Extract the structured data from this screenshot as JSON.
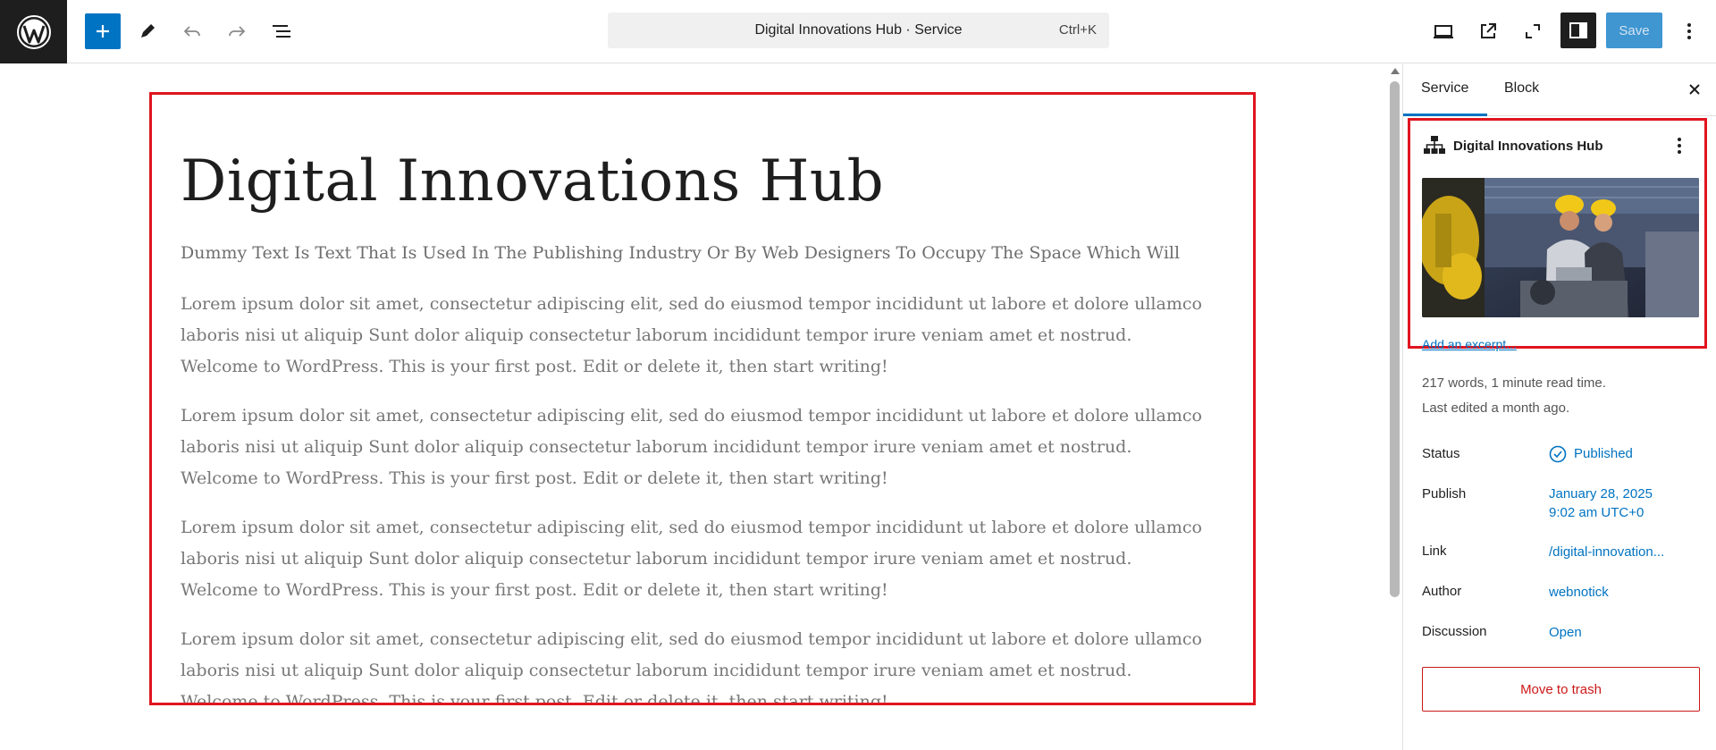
{
  "toolbar": {
    "command_title": "Digital Innovations Hub · Service",
    "command_shortcut": "Ctrl+K",
    "save_label": "Save"
  },
  "post": {
    "title": "Digital Innovations Hub",
    "excerpt": "Dummy Text Is Text That Is Used In The Publishing Industry Or By Web Designers To Occupy The Space Which Will",
    "paragraphs": [
      "Lorem ipsum dolor sit amet, consectetur adipiscing elit, sed do eiusmod tempor incididunt ut labore et dolore ullamco laboris nisi ut aliquip Sunt dolor aliquip consectetur laborum incididunt tempor irure veniam amet et nostrud. Welcome to WordPress. This is your first post. Edit or delete it, then start writing!",
      "Lorem ipsum dolor sit amet, consectetur adipiscing elit, sed do eiusmod tempor incididunt ut labore et dolore ullamco laboris nisi ut aliquip Sunt dolor aliquip consectetur laborum incididunt tempor irure veniam amet et nostrud. Welcome to WordPress. This is your first post. Edit or delete it, then start writing!",
      "Lorem ipsum dolor sit amet, consectetur adipiscing elit, sed do eiusmod tempor incididunt ut labore et dolore ullamco laboris nisi ut aliquip Sunt dolor aliquip consectetur laborum incididunt tempor irure veniam amet et nostrud. Welcome to WordPress. This is your first post. Edit or delete it, then start writing!",
      "Lorem ipsum dolor sit amet, consectetur adipiscing elit, sed do eiusmod tempor incididunt ut labore et dolore ullamco laboris nisi ut aliquip Sunt dolor aliquip consectetur laborum incididunt tempor irure veniam amet et nostrud. Welcome to WordPress. This is your first post. Edit or delete it, then start writing!"
    ]
  },
  "sidebar": {
    "tabs": [
      "Service",
      "Block"
    ],
    "card_title": "Digital Innovations Hub",
    "excerpt_link": "Add an excerpt...",
    "meta_words": "217 words, 1 minute read time.",
    "meta_edited": "Last edited a month ago.",
    "rows": {
      "status_label": "Status",
      "status_value": "Published",
      "publish_label": "Publish",
      "publish_date": "January 28, 2025",
      "publish_time": "9:02 am UTC+0",
      "link_label": "Link",
      "link_value": "/digital-innovation...",
      "author_label": "Author",
      "author_value": "webnotick",
      "discussion_label": "Discussion",
      "discussion_value": "Open"
    },
    "trash_label": "Move to trash"
  },
  "colors": {
    "accent": "#0073c2",
    "highlight": "#e0151f",
    "danger": "#cc1818"
  }
}
